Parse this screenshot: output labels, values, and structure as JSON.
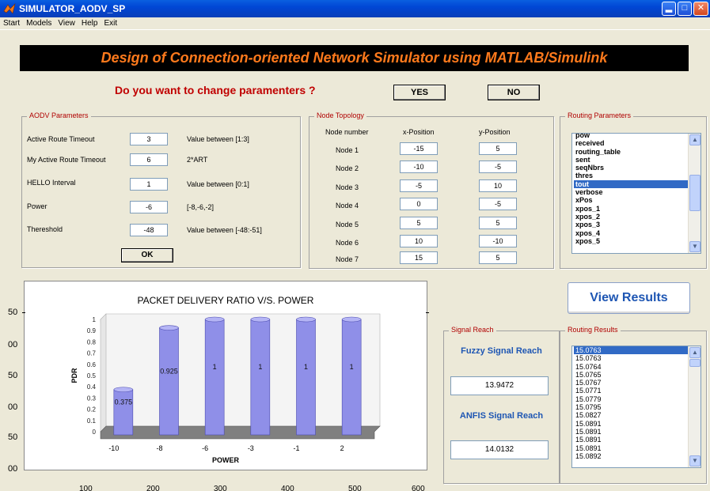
{
  "window": {
    "title": "SIMULATOR_AODV_SP",
    "controls": [
      "minimize",
      "maximize",
      "close"
    ]
  },
  "menu": [
    "Start",
    "Models",
    "View",
    "Help",
    "Exit"
  ],
  "banner": "Design of Connection-oriented Network Simulator using MATLAB/Simulink",
  "question": "Do you want to change paramenters ?",
  "buttons": {
    "yes": "YES",
    "no": "NO",
    "ok": "OK",
    "view_results": "View Results"
  },
  "aodv": {
    "title": "AODV Parameters",
    "rows": [
      {
        "label": "Active Route Timeout",
        "value": "3",
        "hint": "Value between [1:3]"
      },
      {
        "label": "My Active Route Timeout",
        "value": "6",
        "hint": "2*ART"
      },
      {
        "label": "HELLO Interval",
        "value": "1",
        "hint": "Value between [0:1]"
      },
      {
        "label": "Power",
        "value": "-6",
        "hint": "[-8,-6,-2]"
      },
      {
        "label": "Thereshold",
        "value": "-48",
        "hint": "Value between [-48:-51]"
      }
    ]
  },
  "topology": {
    "title": "Node Topology",
    "headers": [
      "Node number",
      "x-Position",
      "y-Position"
    ],
    "nodes": [
      {
        "name": "Node 1",
        "x": "-15",
        "y": "5"
      },
      {
        "name": "Node 2",
        "x": "-10",
        "y": "-5"
      },
      {
        "name": "Node 3",
        "x": "-5",
        "y": "10"
      },
      {
        "name": "Node 4",
        "x": "0",
        "y": "-5"
      },
      {
        "name": "Node 5",
        "x": "5",
        "y": "5"
      },
      {
        "name": "Node 6",
        "x": "10",
        "y": "-10"
      },
      {
        "name": "Node 7",
        "x": "15",
        "y": "5"
      }
    ]
  },
  "routing_parameters": {
    "title": "Routing Parameters",
    "items": [
      "pow",
      "received",
      "routing_table",
      "sent",
      "seqNbrs",
      "thres",
      "tout",
      "verbose",
      "xPos",
      "xpos_1",
      "xpos_2",
      "xpos_3",
      "xpos_4",
      "xpos_5"
    ],
    "selected": "tout"
  },
  "signal": {
    "title": "Signal Reach",
    "fuzzy_label": "Fuzzy Signal Reach",
    "fuzzy_value": "13.9472",
    "anfis_label": "ANFIS Signal Reach",
    "anfis_value": "14.0132"
  },
  "routing_results": {
    "title": "Routing Results",
    "items": [
      "15.0763",
      "15.0763",
      "15.0764",
      "15.0765",
      "15.0767",
      "15.0771",
      "15.0779",
      "15.0795",
      "15.0827",
      "15.0891",
      "15.0891",
      "15.0891",
      "15.0891",
      "15.0892"
    ],
    "selected": "15.0763"
  },
  "background_axis": {
    "y_ticks": [
      "50",
      "00",
      "50",
      "00",
      "50",
      "00"
    ],
    "x_ticks": [
      "100",
      "200",
      "300",
      "400",
      "500",
      "600"
    ]
  },
  "chart_data": {
    "type": "bar",
    "title": "PACKET DELIVERY RATIO V/S. POWER",
    "xlabel": "POWER",
    "ylabel": "PDR",
    "categories": [
      "-10",
      "-8",
      "-6",
      "-3",
      "-1",
      "2"
    ],
    "values": [
      0.375,
      0.925,
      1,
      1,
      1,
      1
    ],
    "value_labels": [
      "0.375",
      "0.925",
      "1",
      "1",
      "1",
      "1"
    ],
    "y_ticks": [
      "0",
      "0.1",
      "0.2",
      "0.3",
      "0.4",
      "0.5",
      "0.6",
      "0.7",
      "0.8",
      "0.9",
      "1"
    ],
    "ylim": [
      0,
      1
    ],
    "bar_color": "#8f8fe8",
    "floor_color": "#808080",
    "style": "3d-cylinder"
  }
}
